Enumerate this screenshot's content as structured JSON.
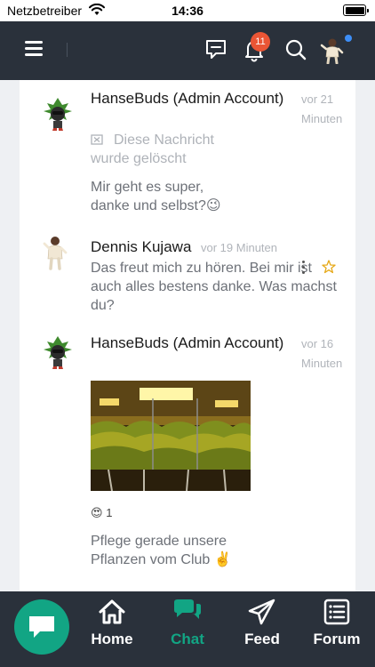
{
  "status": {
    "carrier": "Netzbetreiber",
    "time": "14:36"
  },
  "header": {
    "notification_count": "11"
  },
  "messages": [
    {
      "author": "HanseBuds (Admin Account)",
      "time": "vor 21 Minuten",
      "deleted_notice": "Diese Nachricht wurde gelöscht",
      "text": "Mir geht es super, danke und selbst?😉"
    },
    {
      "author": "Dennis Kujawa",
      "time": "vor 19 Minuten",
      "text": "Das freut mich zu hören. Bei mir ist auch alles bestens danke. Was machst du?"
    },
    {
      "author": "HanseBuds (Admin Account)",
      "time": "vor 16 Minuten",
      "reaction_emoji": "😍",
      "reaction_count": "1",
      "text": "Pflege gerade unsere Pflanzen vom Club ✌️"
    }
  ],
  "bottom_nav": {
    "items": [
      {
        "label": "Home"
      },
      {
        "label": "Chat"
      },
      {
        "label": "Feed"
      },
      {
        "label": "Forum"
      }
    ],
    "active_color": "#12a584"
  },
  "colors": {
    "header_bg": "#2a313b",
    "accent": "#12a584",
    "badge": "#ea5535"
  }
}
